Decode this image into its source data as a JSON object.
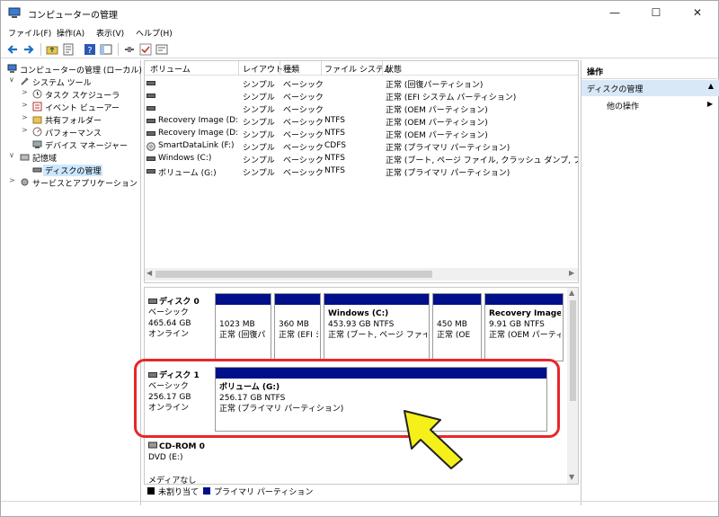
{
  "window": {
    "title": "コンピューターの管理"
  },
  "window_controls": {
    "minimize": "—",
    "maximize": "☐",
    "close": "✕"
  },
  "menu": [
    {
      "label": "ファイル(F)"
    },
    {
      "label": "操作(A)"
    },
    {
      "label": "表示(V)"
    },
    {
      "label": "ヘルプ(H)"
    }
  ],
  "toolbar": {
    "icons": [
      "back-icon",
      "forward-icon",
      "up-folder-icon",
      "properties-icon",
      "help-icon",
      "console-tree-icon",
      "connect-icon",
      "check-icon",
      "options-icon"
    ]
  },
  "tree": {
    "items": [
      {
        "label": "コンピューターの管理 (ローカル)",
        "exp": ""
      },
      {
        "label": "システム ツール",
        "exp": "∨"
      },
      {
        "label": "タスク スケジューラ",
        "exp": ">"
      },
      {
        "label": "イベント ビューアー",
        "exp": ">"
      },
      {
        "label": "共有フォルダー",
        "exp": ">"
      },
      {
        "label": "パフォーマンス",
        "exp": ">"
      },
      {
        "label": "デバイス マネージャー",
        "exp": ""
      },
      {
        "label": "記憶域",
        "exp": "∨"
      },
      {
        "label": "ディスクの管理",
        "exp": ""
      },
      {
        "label": "サービスとアプリケーション",
        "exp": ">"
      }
    ]
  },
  "volume_list": {
    "columns": [
      "ボリューム",
      "レイアウト",
      "種類",
      "ファイル システム",
      "状態"
    ],
    "rows": [
      {
        "volume": "",
        "layout": "シンプル",
        "type": "ベーシック",
        "fs": "",
        "status": "正常 (回復パーティション)"
      },
      {
        "volume": "",
        "layout": "シンプル",
        "type": "ベーシック",
        "fs": "",
        "status": "正常 (EFI システム パーティション)"
      },
      {
        "volume": "",
        "layout": "シンプル",
        "type": "ベーシック",
        "fs": "",
        "status": "正常 (OEM パーティション)"
      },
      {
        "volume": "Recovery Image (D:)",
        "layout": "シンプル",
        "type": "ベーシック",
        "fs": "NTFS",
        "status": "正常 (OEM パーティション)"
      },
      {
        "volume": "Recovery Image (D:)",
        "layout": "シンプル",
        "type": "ベーシック",
        "fs": "NTFS",
        "status": "正常 (OEM パーティション)"
      },
      {
        "volume": "SmartDataLink (F:)",
        "layout": "シンプル",
        "type": "ベーシック",
        "fs": "CDFS",
        "status": "正常 (プライマリ パーティション)"
      },
      {
        "volume": "Windows (C:)",
        "layout": "シンプル",
        "type": "ベーシック",
        "fs": "NTFS",
        "status": "正常 (ブート, ページ ファイル, クラッシュ ダンプ, プライマリ パ"
      },
      {
        "volume": "ボリューム (G:)",
        "layout": "シンプル",
        "type": "ベーシック",
        "fs": "NTFS",
        "status": "正常 (プライマリ パーティション)"
      }
    ]
  },
  "disks": [
    {
      "name": "ディスク 0",
      "kind": "ベーシック",
      "size": "465.64 GB",
      "state": "オンライン",
      "partitions": [
        {
          "title": "",
          "size": "1023 MB",
          "status": "正常 (回復パ"
        },
        {
          "title": "",
          "size": "360 MB",
          "status": "正常 (EFI シ"
        },
        {
          "title": "Windows (C:)",
          "size": "453.93 GB NTFS",
          "status": "正常 (ブート, ページ ファイル, ク"
        },
        {
          "title": "",
          "size": "450 MB",
          "status": "正常 (OE"
        },
        {
          "title": "Recovery Image (",
          "size": "9.91 GB NTFS",
          "status": "正常 (OEM パーティ"
        }
      ]
    },
    {
      "name": "ディスク 1",
      "kind": "ベーシック",
      "size": "256.17 GB",
      "state": "オンライン",
      "partitions": [
        {
          "title": "ボリューム (G:)",
          "size": "256.17 GB NTFS",
          "status": "正常 (プライマリ パーティション)"
        }
      ]
    },
    {
      "name": "CD-ROM 0",
      "kind": "DVD (E:)",
      "size": "",
      "state": "メディアなし",
      "partitions": []
    }
  ],
  "legend": [
    {
      "label": "未割り当て",
      "color": "#000000"
    },
    {
      "label": "プライマリ パーティション",
      "color": "#000f8a"
    }
  ],
  "actions": {
    "header": "操作",
    "section": "ディスクの管理",
    "item": "他の操作"
  },
  "colors": {
    "partition_bar": "#000f8a",
    "annotation": "#e8272a",
    "arrow": "#f5f01a",
    "selection": "#cce8ff"
  }
}
